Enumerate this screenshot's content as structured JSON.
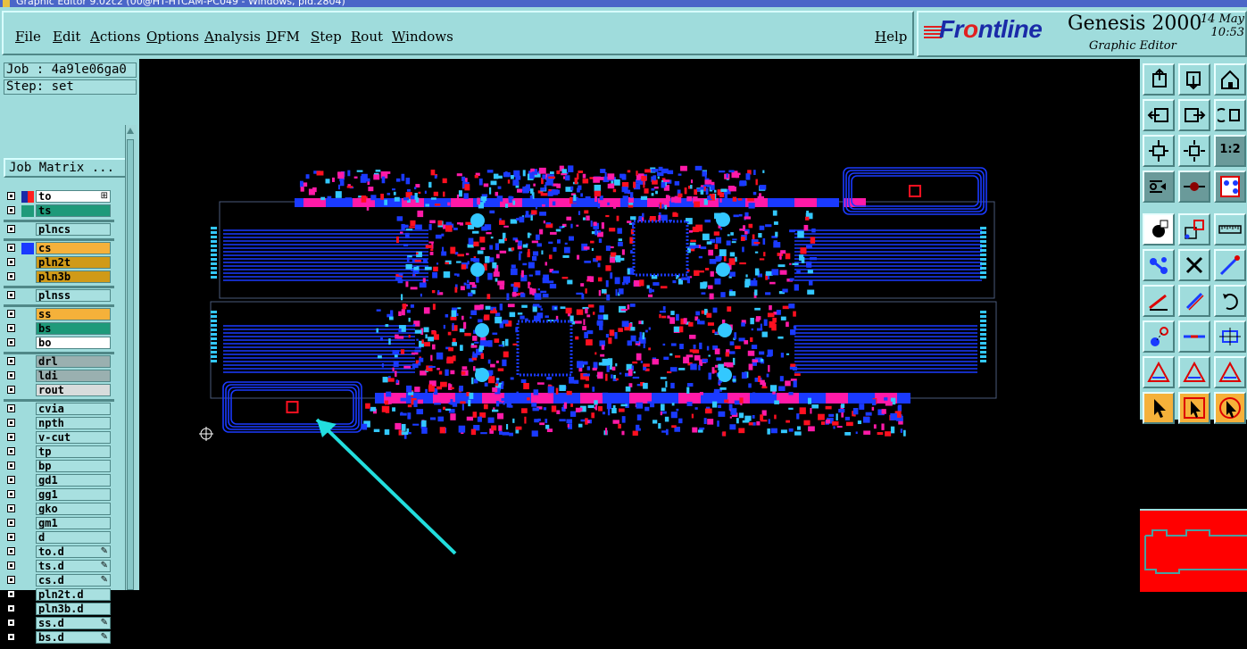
{
  "window": {
    "title": "Graphic Editor 9.02c2 (00@HT-HTCAM-PC049 - Windows, pid.2804)"
  },
  "menubar": {
    "items": [
      "File",
      "Edit",
      "Actions",
      "Options",
      "Analysis",
      "DFM",
      "Step",
      "Rout",
      "Windows"
    ],
    "help": "Help"
  },
  "brand": {
    "logo": "Frontline",
    "product": "Genesis 2000",
    "subtitle": "Graphic Editor",
    "date": "14 May",
    "time": "10:53"
  },
  "job": {
    "label": "Job : 4a9le06ga0",
    "step": "Step: set"
  },
  "job_matrix_button": "Job Matrix ...",
  "layers": [
    {
      "name": "to",
      "color": "#ffffff",
      "swatch": [
        "#1a2aa8",
        "#ff2020"
      ],
      "pen": "⊞"
    },
    {
      "name": "ts",
      "color": "#1e9a7a",
      "swatch": [
        "#1e9a7a",
        "#1e9a7a"
      ]
    },
    {
      "name": "plncs",
      "color": "#a8e0e0",
      "swatch": []
    },
    {
      "name": "cs",
      "color": "#f5b13a",
      "swatch": [
        "#1a3aff"
      ]
    },
    {
      "name": "pln2t",
      "color": "#d09a18",
      "swatch": []
    },
    {
      "name": "pln3b",
      "color": "#d09a18",
      "swatch": []
    },
    {
      "name": "plnss",
      "color": "#a8e0e0",
      "swatch": []
    },
    {
      "name": "ss",
      "color": "#f5b13a",
      "swatch": []
    },
    {
      "name": "bs",
      "color": "#1e9a7a",
      "swatch": []
    },
    {
      "name": "bo",
      "color": "#ffffff",
      "swatch": []
    },
    {
      "name": "drl",
      "color": "#9ab0b0",
      "swatch": []
    },
    {
      "name": "ldi",
      "color": "#9ab0b0",
      "swatch": []
    },
    {
      "name": "rout",
      "color": "#d8dcdc",
      "swatch": []
    },
    {
      "name": "cvia",
      "color": "#a8e0e0",
      "swatch": []
    },
    {
      "name": "npth",
      "color": "#a8e0e0",
      "swatch": []
    },
    {
      "name": "v-cut",
      "color": "#a8e0e0",
      "swatch": []
    },
    {
      "name": "tp",
      "color": "#a8e0e0",
      "swatch": []
    },
    {
      "name": "bp",
      "color": "#a8e0e0",
      "swatch": []
    },
    {
      "name": "gd1",
      "color": "#a8e0e0",
      "swatch": []
    },
    {
      "name": "gg1",
      "color": "#a8e0e0",
      "swatch": []
    },
    {
      "name": "gko",
      "color": "#a8e0e0",
      "swatch": []
    },
    {
      "name": "gm1",
      "color": "#a8e0e0",
      "swatch": []
    },
    {
      "name": "d",
      "color": "#a8e0e0",
      "swatch": []
    },
    {
      "name": "to.d",
      "color": "#a8e0e0",
      "swatch": [],
      "pen": "✎"
    },
    {
      "name": "ts.d",
      "color": "#a8e0e0",
      "swatch": [],
      "pen": "✎"
    },
    {
      "name": "cs.d",
      "color": "#a8e0e0",
      "swatch": [],
      "pen": "✎"
    },
    {
      "name": "pln2t.d",
      "color": "#a8e0e0",
      "swatch": []
    },
    {
      "name": "pln3b.d",
      "color": "#a8e0e0",
      "swatch": []
    },
    {
      "name": "ss.d",
      "color": "#a8e0e0",
      "swatch": [],
      "pen": "✎"
    },
    {
      "name": "bs.d",
      "color": "#a8e0e0",
      "swatch": [],
      "pen": "✎"
    }
  ],
  "tools": [
    {
      "name": "tool-page-up",
      "icon": "page-up-icon"
    },
    {
      "name": "tool-page-down",
      "icon": "page-down-icon"
    },
    {
      "name": "tool-home",
      "icon": "home-icon"
    },
    {
      "name": "tool-pan-left",
      "icon": "pan-left-icon"
    },
    {
      "name": "tool-pan-right",
      "icon": "pan-right-icon"
    },
    {
      "name": "tool-zoom-back",
      "icon": "zoom-back-icon"
    },
    {
      "name": "tool-fit-vertical",
      "icon": "fit-vertical-icon"
    },
    {
      "name": "tool-fit-all",
      "icon": "fit-all-icon"
    },
    {
      "name": "tool-scale",
      "icon": "scale-icon",
      "label": "1:2"
    },
    {
      "name": "tool-measure",
      "icon": "measure-icon"
    },
    {
      "name": "tool-connector",
      "icon": "connector-icon"
    },
    {
      "name": "tool-net-select",
      "icon": "net-select-icon"
    },
    {
      "name": "tool-snap-pad",
      "icon": "snap-pad-icon"
    },
    {
      "name": "tool-select-area",
      "icon": "select-area-icon"
    },
    {
      "name": "tool-ruler",
      "icon": "ruler-icon"
    },
    {
      "name": "tool-add-node",
      "icon": "add-node-icon"
    },
    {
      "name": "tool-cross",
      "icon": "cross-icon"
    },
    {
      "name": "tool-line-end",
      "icon": "line-end-icon"
    },
    {
      "name": "tool-angle-line",
      "icon": "angle-line-icon"
    },
    {
      "name": "tool-diagonal",
      "icon": "diagonal-icon"
    },
    {
      "name": "tool-rotate",
      "icon": "rotate-icon"
    },
    {
      "name": "tool-move-pad",
      "icon": "move-pad-icon"
    },
    {
      "name": "tool-split-line",
      "icon": "split-line-icon"
    },
    {
      "name": "tool-center",
      "icon": "center-icon"
    },
    {
      "name": "tool-triangle-a",
      "icon": "triangle-icon"
    },
    {
      "name": "tool-triangle-b",
      "icon": "triangle-icon"
    },
    {
      "name": "tool-triangle-c",
      "icon": "triangle-icon"
    },
    {
      "name": "tool-pointer",
      "icon": "pointer-icon"
    },
    {
      "name": "tool-pointer-box",
      "icon": "pointer-box-icon"
    },
    {
      "name": "tool-pointer-circle",
      "icon": "pointer-circle-icon"
    }
  ],
  "colors": {
    "panel": "#9fdcdc",
    "trace_blue": "#1a3aff",
    "pad_magenta": "#ff1aa8",
    "pad_red": "#ff1020",
    "pad_cyan": "#33c8ff",
    "arrow": "#22dede",
    "minimap": "#ff0000"
  }
}
